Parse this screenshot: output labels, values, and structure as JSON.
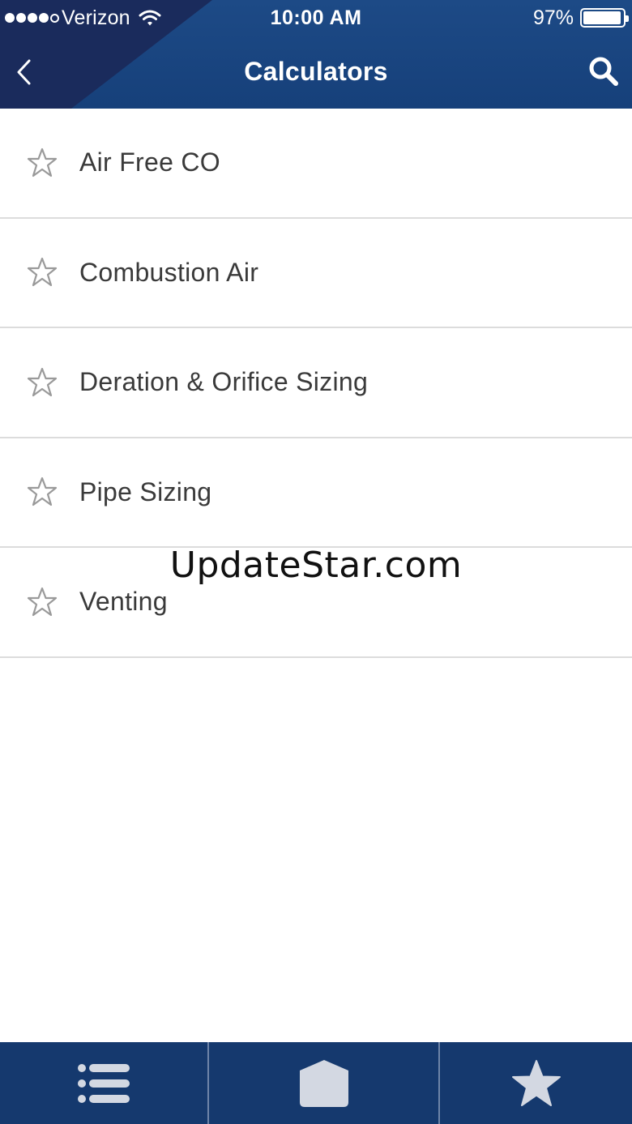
{
  "status_bar": {
    "carrier": "Verizon",
    "time": "10:00 AM",
    "battery_percent": "97%",
    "signal_bars_filled": 4,
    "signal_bars_total": 5
  },
  "nav": {
    "title": "Calculators",
    "back_icon": "chevron-left-icon",
    "search_icon": "search-icon"
  },
  "list": {
    "items": [
      {
        "label": "Air Free CO",
        "icon": "star-outline-icon"
      },
      {
        "label": "Combustion Air",
        "icon": "star-outline-icon"
      },
      {
        "label": "Deration & Orifice Sizing",
        "icon": "star-outline-icon"
      },
      {
        "label": "Pipe Sizing",
        "icon": "star-outline-icon"
      },
      {
        "label": "Venting",
        "icon": "star-outline-icon"
      }
    ]
  },
  "watermark": "UpdateStar.com",
  "tab_bar": {
    "tabs": [
      {
        "icon": "list-icon"
      },
      {
        "icon": "home-icon"
      },
      {
        "icon": "star-icon"
      }
    ]
  },
  "colors": {
    "header_blue": "#1d4a86",
    "header_dark": "#1a2b5c",
    "tab_bar": "#15396e",
    "tab_icon": "#d3d8e2",
    "star_outline": "#9a9a9a",
    "label_text": "#3a3a3a"
  }
}
